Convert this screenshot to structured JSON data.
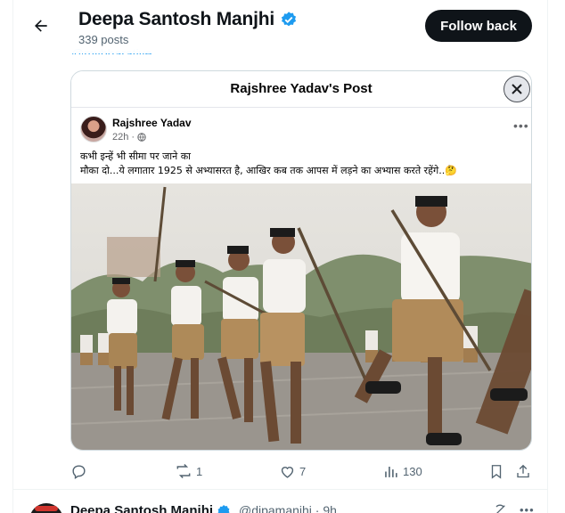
{
  "header": {
    "profile_name": "Deepa Santosh Manjhi",
    "post_count": "339 posts",
    "follow_back_label": "Follow back"
  },
  "peek_handle": "@mybharative",
  "card": {
    "title": "Rajshree Yadav's Post",
    "author": "Rajshree Yadav",
    "time": "22h",
    "text_line1": "कभी इन्हें भी सीमा पर जाने का",
    "text_line2": "मौका दो...ये लगातार 1925 से अभ्यासरत है, आखिर कब तक आपस में लड़ने  का अभ्यास करते रहेंगे..🤔"
  },
  "actions": {
    "replies": "",
    "reposts": "1",
    "likes": "7",
    "views": "130"
  },
  "next_tweet": {
    "name": "Deepa Santosh Manjhi",
    "handle_time": "@dipamanjhi · 9h"
  },
  "colors": {
    "accent": "#1d9bf0",
    "text": "#0f1419",
    "muted": "#536471",
    "button_bg": "#0f1419"
  },
  "icons": [
    "back-arrow-icon",
    "verified-badge-icon",
    "close-icon",
    "globe-icon",
    "more-icon",
    "reply-icon",
    "repost-icon",
    "like-icon",
    "views-icon",
    "bookmark-icon",
    "share-icon",
    "grok-icon"
  ]
}
